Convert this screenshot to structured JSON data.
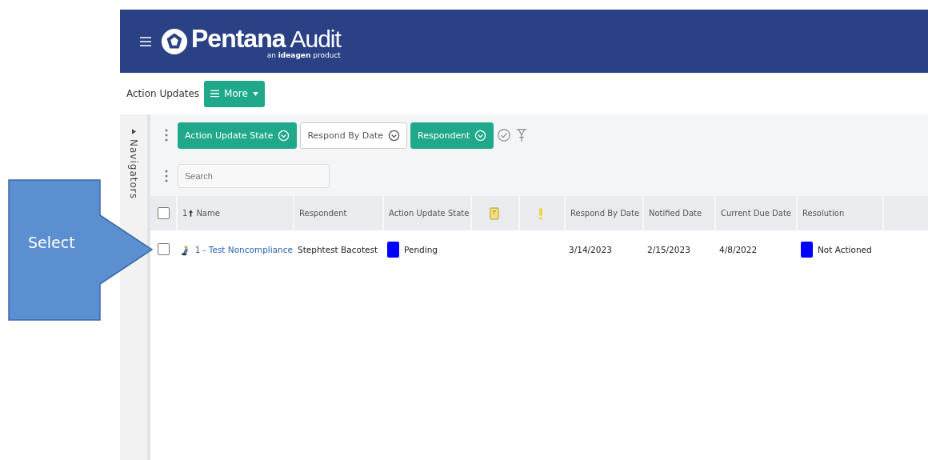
{
  "header": {
    "brand": "Pentana",
    "product": "Audit",
    "tagline_prefix": "an",
    "tagline_brand": "ideagen",
    "tagline_suffix": "product"
  },
  "toolbar": {
    "title": "Action Updates",
    "more_button": "More"
  },
  "navigator": {
    "label": "Navigators",
    "expanded": false
  },
  "filters": [
    {
      "label": "Action Update State",
      "active": true
    },
    {
      "label": "Respond By Date",
      "active": false
    },
    {
      "label": "Respondent",
      "active": true
    }
  ],
  "search": {
    "placeholder": "Search"
  },
  "table": {
    "columns": [
      {
        "kind": "text",
        "label": "Name",
        "sort": "1"
      },
      {
        "kind": "text",
        "label": "Respondent"
      },
      {
        "kind": "text",
        "label": "Action Update State"
      },
      {
        "kind": "note-icon"
      },
      {
        "kind": "alert-icon"
      },
      {
        "kind": "text",
        "label": "Respond By Date"
      },
      {
        "kind": "text",
        "label": "Notified Date"
      },
      {
        "kind": "text",
        "label": "Current Due Date"
      },
      {
        "kind": "text",
        "label": "Resolution"
      }
    ],
    "header_checked": false,
    "rows": [
      {
        "checked": false,
        "name": "1 - Test Noncompliance",
        "respondent": "Stephtest Bacotest",
        "state": {
          "label": "Pending",
          "color": "#0000ff"
        },
        "respond_by": "3/14/2023",
        "notified": "2/15/2023",
        "current_due": "4/8/2022",
        "resolution": {
          "label": "Not Actioned",
          "color": "#0000ff"
        }
      }
    ]
  },
  "callout": {
    "label": "Select"
  }
}
